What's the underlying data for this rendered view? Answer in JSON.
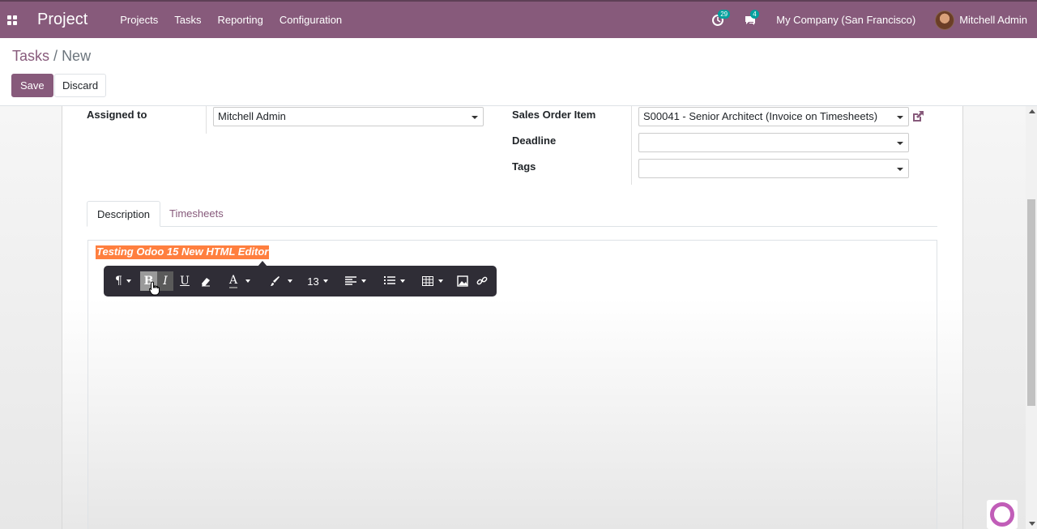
{
  "navbar": {
    "app_name": "Project",
    "menu": [
      "Projects",
      "Tasks",
      "Reporting",
      "Configuration"
    ],
    "activity_badge": "29",
    "messages_badge": "4",
    "company": "My Company (San Francisco)",
    "user": "Mitchell Admin",
    "color": "#875a7b"
  },
  "breadcrumb": {
    "parent": "Tasks",
    "separator": "/",
    "current": "New"
  },
  "buttons": {
    "save": "Save",
    "discard": "Discard"
  },
  "form": {
    "assigned_to_label": "Assigned to",
    "assigned_to_value": "Mitchell Admin",
    "sales_order_item_label": "Sales Order Item",
    "sales_order_item_value": "S00041 - Senior Architect (Invoice on Timesheets)",
    "deadline_label": "Deadline",
    "deadline_value": "",
    "tags_label": "Tags",
    "tags_value": ""
  },
  "tabs": [
    "Description",
    "Timesheets"
  ],
  "editor": {
    "content": "Testing Odoo 15 New HTML Editor",
    "highlight_color": "#ff7f3f"
  },
  "toolbar": {
    "paragraph": "¶",
    "bold": "B",
    "italic": "I",
    "underline": "U",
    "font_color": "A",
    "font_size": "13",
    "icons": [
      "paragraph-icon",
      "bold-icon",
      "italic-icon",
      "underline-icon",
      "eraser-icon",
      "font-color-icon",
      "brush-icon",
      "align-icon",
      "list-icon",
      "table-icon",
      "image-icon",
      "link-icon"
    ]
  }
}
